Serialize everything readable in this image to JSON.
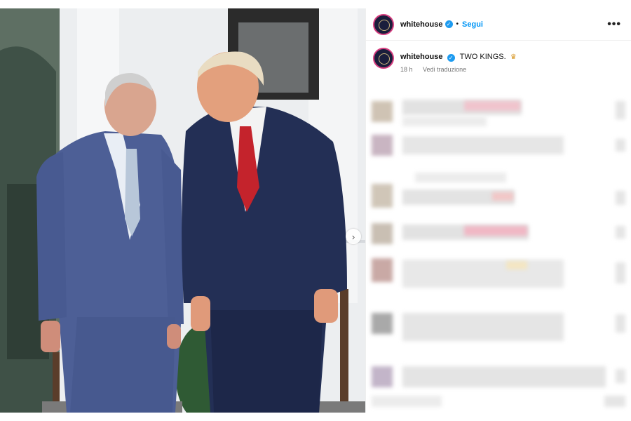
{
  "post": {
    "username": "whitehouse",
    "verified_icon": "verified-badge-icon",
    "separator": "•",
    "follow_label": "Segui",
    "more_label": "•••",
    "caption": {
      "username": "whitehouse",
      "text": "TWO KINGS.",
      "emoji": "♛",
      "time": "18 h",
      "translate_label": "Vedi traduzione"
    }
  },
  "photo": {
    "next_label": "›"
  },
  "colors": {
    "accent_blue": "#0095f6",
    "verified_blue": "#1d9bf0",
    "ring_pink": "#d63d7f"
  }
}
